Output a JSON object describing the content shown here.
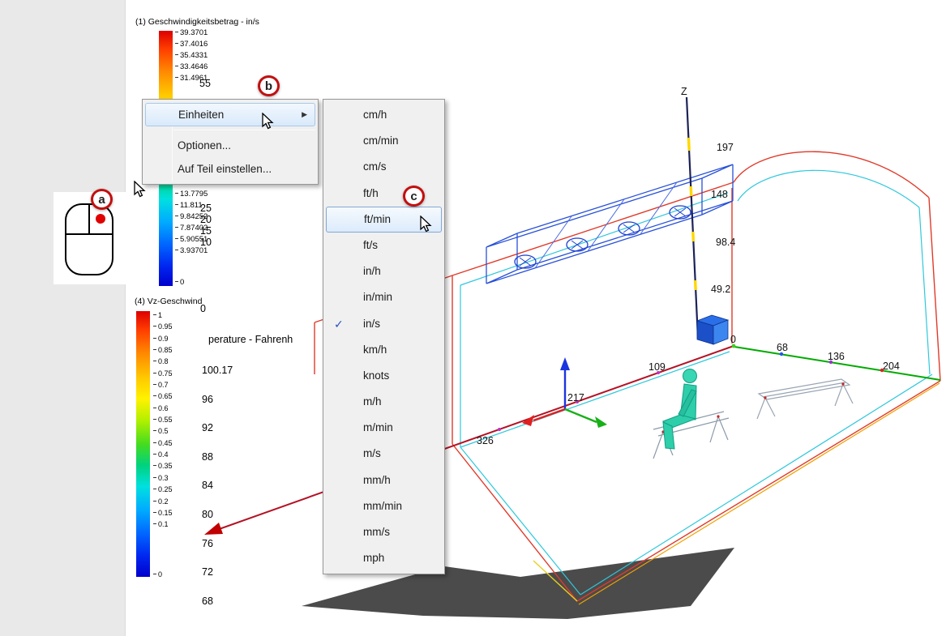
{
  "callouts": {
    "a": "a",
    "b": "b",
    "c": "c"
  },
  "legends": {
    "velocity": {
      "title": "(1) Geschwindigkeitsbetrag - in/s",
      "upper_labels": [
        "39.3701",
        "37.4016",
        "35.4331",
        "33.4646",
        "31.4961"
      ],
      "lower_labels": [
        "13.7795",
        "11.811",
        "9.84252",
        "7.87402",
        "5.90551",
        "3.93701"
      ],
      "min_label": "0"
    },
    "hidden_scale": {
      "upper_label": "55",
      "lower_labels": [
        "25",
        "20",
        "15",
        "10"
      ],
      "min_label": "0"
    },
    "vz": {
      "title": "(4) Vz-Geschwind",
      "labels": [
        "1",
        "0.95",
        "0.9",
        "0.85",
        "0.8",
        "0.75",
        "0.7",
        "0.65",
        "0.6",
        "0.55",
        "0.5",
        "0.45",
        "0.4",
        "0.35",
        "0.3",
        "0.25",
        "0.2",
        "0.15",
        "0.1"
      ],
      "min_label": "0"
    },
    "temperature": {
      "title": "perature - Fahrenh",
      "labels": [
        "100.17",
        "96",
        "92",
        "88",
        "84",
        "80",
        "76",
        "72",
        "68"
      ]
    }
  },
  "context_menu": {
    "submenu_arrow": "▶",
    "items": [
      {
        "label": "Einheiten"
      },
      {
        "label": "Optionen..."
      },
      {
        "label": "Auf Teil einstellen..."
      }
    ]
  },
  "units_menu": {
    "items": [
      {
        "label": "cm/h"
      },
      {
        "label": "cm/min"
      },
      {
        "label": "cm/s"
      },
      {
        "label": "ft/h"
      },
      {
        "label": "ft/min",
        "state": "hovered"
      },
      {
        "label": "ft/s"
      },
      {
        "label": "in/h"
      },
      {
        "label": "in/min"
      },
      {
        "label": "in/s",
        "state": "checked",
        "check": "✓"
      },
      {
        "label": "km/h"
      },
      {
        "label": "knots"
      },
      {
        "label": "m/h"
      },
      {
        "label": "m/min"
      },
      {
        "label": "m/s"
      },
      {
        "label": "mm/h"
      },
      {
        "label": "mm/min"
      },
      {
        "label": "mm/s"
      },
      {
        "label": "mph"
      }
    ]
  },
  "viewport": {
    "z_axis": {
      "label": "Z",
      "ticks": [
        "197",
        "148",
        "98.4",
        "49.2"
      ],
      "origin_label": "0"
    },
    "x_ruler": {
      "ticks": [
        "109",
        "217",
        "326"
      ]
    },
    "y_ruler": {
      "ticks": [
        "68",
        "136",
        "204"
      ]
    }
  }
}
